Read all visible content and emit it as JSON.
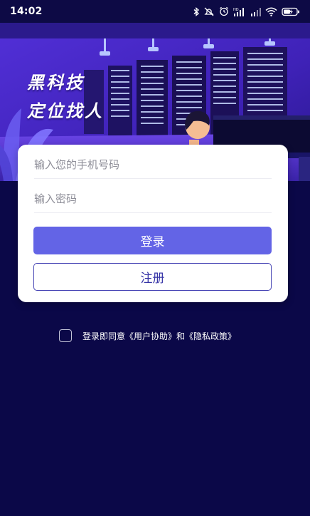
{
  "status_bar": {
    "time": "14:02",
    "icons": [
      "bluetooth-icon",
      "mute-icon",
      "alarm-icon",
      "signal-hd-icon",
      "signal-icon",
      "wifi-icon",
      "battery-charging-icon"
    ]
  },
  "banner": {
    "line1": "黑科技",
    "line2": "定位找人"
  },
  "login_form": {
    "phone_placeholder": "输入您的手机号码",
    "password_placeholder": "输入密码",
    "login_button": "登录",
    "register_button": "注册"
  },
  "agreement": {
    "prefix": "登录即同意",
    "user_agreement": "《用户协助》",
    "conjunction": "和",
    "privacy_policy": "《隐私政策》"
  },
  "colors": {
    "background": "#0b0848",
    "primary_button": "#6364e6",
    "register_border": "#4644b4",
    "banner_purple": "#4a2ad0"
  }
}
